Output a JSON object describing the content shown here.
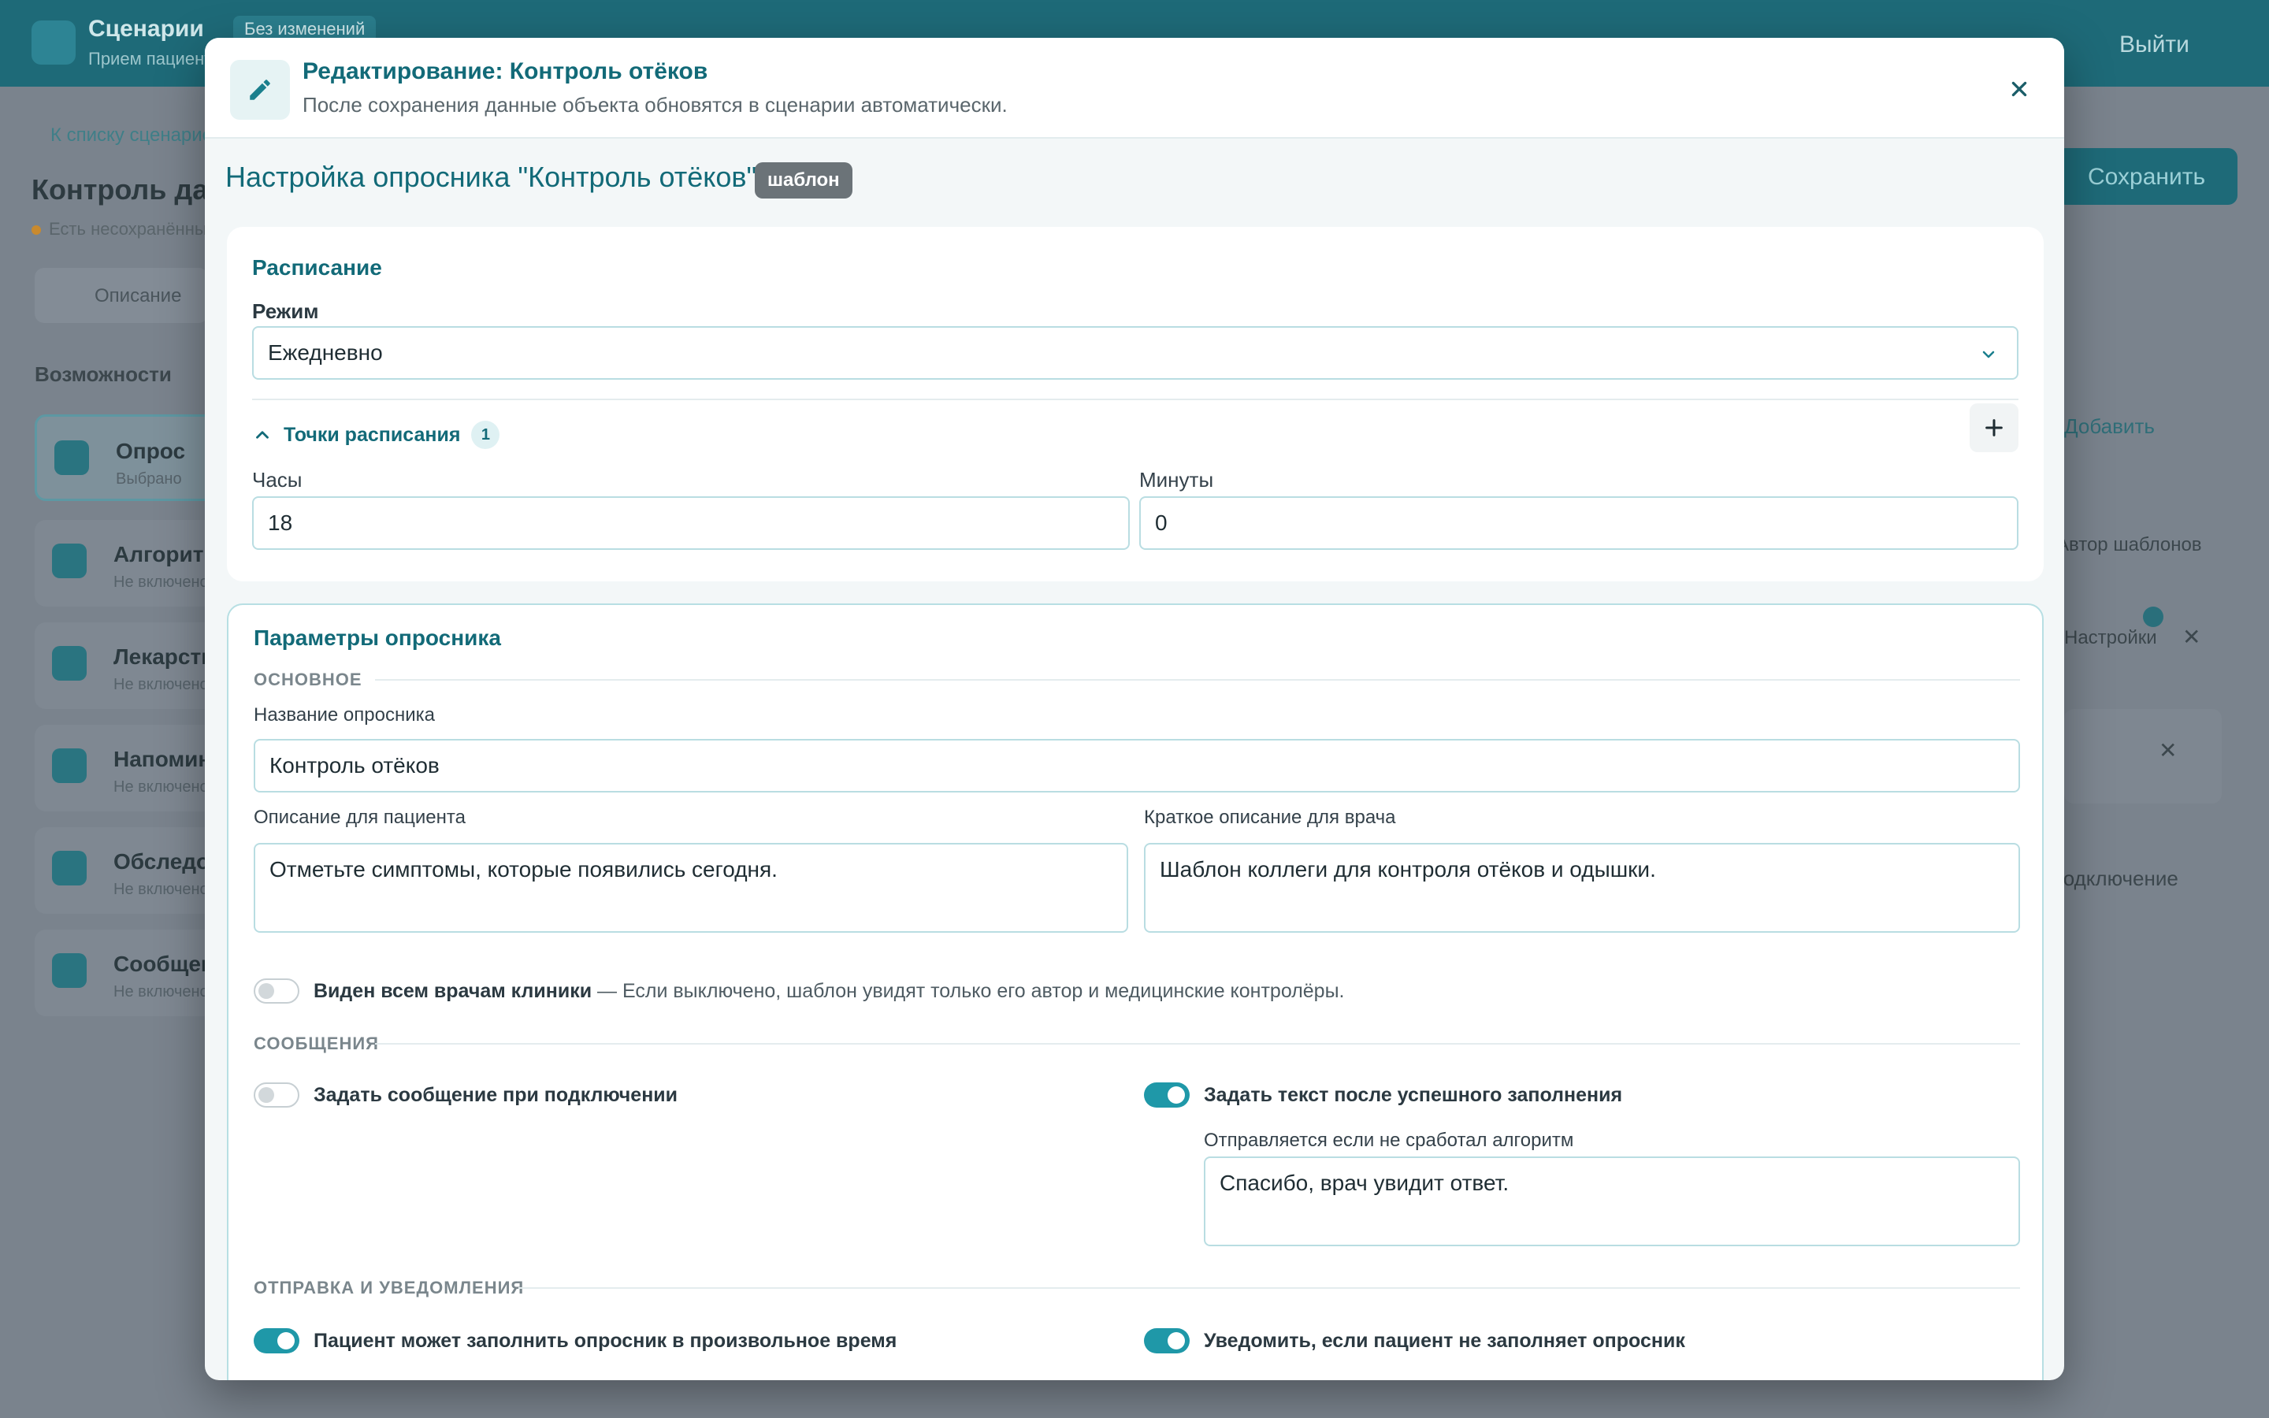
{
  "background": {
    "app_title": "Сценарии",
    "app_subtitle": "Прием пациентов",
    "header_chip": "Без изменений",
    "logout": "Выйти",
    "back_link": "К списку сценариев",
    "page_title": "Контроль дав",
    "unsaved": "Есть несохранённые изменения",
    "tab": "Описание",
    "section": "Возможности",
    "cards": [
      {
        "title": "Опрос",
        "sub": "Выбрано"
      },
      {
        "title": "Алгоритм",
        "sub": "Не включено"
      },
      {
        "title": "Лекарства",
        "sub": "Не включено"
      },
      {
        "title": "Напоминания",
        "sub": "Не включено"
      },
      {
        "title": "Обследования",
        "sub": "Не включено"
      },
      {
        "title": "Сообщения",
        "sub": "Не включено"
      }
    ],
    "save": "Сохранить",
    "add": "Добавить",
    "right1": "Автор шаблонов",
    "right2": "Настройки",
    "right3": "Подключение"
  },
  "modal": {
    "title": "Редактирование: Контроль отёков",
    "subtitle": "После сохранения данные объекта обновятся в сценарии автоматически.",
    "close_icon": "close-icon",
    "config_title": "Настройка опросника \"Контроль отёков\"",
    "template_badge": "шаблон"
  },
  "schedule": {
    "title": "Расписание",
    "mode_label": "Режим",
    "mode_value": "Ежедневно",
    "points_label": "Точки расписания",
    "points_count": "1",
    "hours_label": "Часы",
    "hours_value": "18",
    "minutes_label": "Минуты",
    "minutes_value": "0"
  },
  "params": {
    "title": "Параметры опросника",
    "section_basic": "ОСНОВНОЕ",
    "name_label": "Название опросника",
    "name_value": "Контроль отёков",
    "patient_desc_label": "Описание для пациента",
    "patient_desc_value": "Отметьте симптомы, которые появились сегодня.",
    "doctor_desc_label": "Краткое описание для врача",
    "doctor_desc_value": "Шаблон коллеги для контроля отёков и одышки.",
    "visible_label": "Виден всем врачам клиники",
    "visible_desc": " — Если выключено, шаблон увидят только его автор и медицинские контролёры.",
    "visible_on": false,
    "section_messages": "СООБЩЕНИЯ",
    "connect_msg_label": "Задать сообщение при подключении",
    "connect_msg_on": false,
    "after_fill_label": "Задать текст после успешного заполнения",
    "after_fill_on": true,
    "after_fill_hint": "Отправляется если не сработал алгоритм",
    "after_fill_value": "Спасибо, врач увидит ответ.",
    "section_notify": "ОТПРАВКА И УВЕДОМЛЕНИЯ",
    "anytime_label": "Пациент может заполнить опросник в произвольное время",
    "anytime_on": true,
    "notify_label": "Уведомить, если пациент не заполняет опросник",
    "notify_on": true
  }
}
